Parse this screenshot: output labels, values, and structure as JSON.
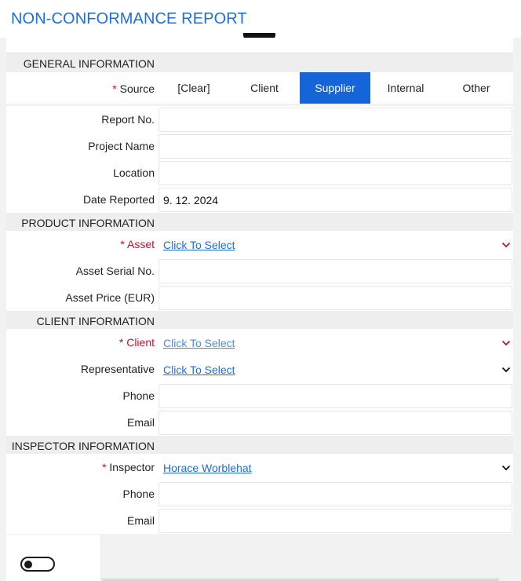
{
  "page": {
    "title": "NON-CONFORMANCE REPORT"
  },
  "general": {
    "heading": "GENERAL INFORMATION",
    "source": {
      "label": "Source",
      "options": [
        "[Clear]",
        "Client",
        "Supplier",
        "Internal",
        "Other"
      ],
      "selected": "Supplier"
    },
    "report_no": {
      "label": "Report No.",
      "value": ""
    },
    "project_name": {
      "label": "Project Name",
      "value": ""
    },
    "location": {
      "label": "Location",
      "value": ""
    },
    "date_reported": {
      "label": "Date Reported",
      "value": "9. 12. 2024"
    }
  },
  "product": {
    "heading": "PRODUCT INFORMATION",
    "asset": {
      "label": "Asset",
      "value": "Click To Select"
    },
    "asset_serial": {
      "label": "Asset Serial No.",
      "value": ""
    },
    "asset_price": {
      "label": "Asset Price (EUR)",
      "value": ""
    }
  },
  "client": {
    "heading": "CLIENT INFORMATION",
    "client": {
      "label": "Client",
      "value": "Click To Select"
    },
    "representative": {
      "label": "Representative",
      "value": "Click To Select"
    },
    "phone": {
      "label": "Phone",
      "value": ""
    },
    "email": {
      "label": "Email",
      "value": ""
    }
  },
  "inspector": {
    "heading": "INSPECTOR INFORMATION",
    "inspector": {
      "label": "Inspector",
      "value": "Horace Worblehat"
    },
    "phone": {
      "label": "Phone",
      "value": ""
    },
    "email": {
      "label": "Email",
      "value": ""
    }
  },
  "required_marker": "*",
  "colors": {
    "accent": "#1565d8",
    "title": "#1e6fd9",
    "required": "#c8102e",
    "section_bg": "#eeeeee"
  },
  "icons": {
    "dropdown": "chevron-down-icon",
    "toggle": "toggle-switch"
  }
}
